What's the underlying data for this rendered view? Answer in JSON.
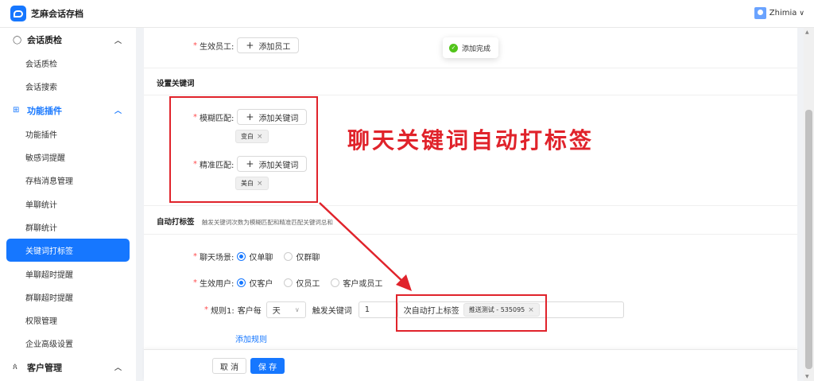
{
  "app": {
    "title": "芝麻会话存档",
    "user_name": "Zhimia"
  },
  "sidebar": {
    "sections": [
      {
        "label": "会话质检",
        "active": false,
        "items": [
          {
            "label": "会话质检",
            "selected": false
          },
          {
            "label": "会话搜索",
            "selected": false
          }
        ]
      },
      {
        "label": "功能插件",
        "active": true,
        "items": [
          {
            "label": "功能插件",
            "selected": false
          },
          {
            "label": "敏感词提醒",
            "selected": false
          },
          {
            "label": "存档消息管理",
            "selected": false
          },
          {
            "label": "单聊统计",
            "selected": false
          },
          {
            "label": "群聊统计",
            "selected": false
          },
          {
            "label": "关键词打标签",
            "selected": true
          },
          {
            "label": "单聊超时提醒",
            "selected": false
          },
          {
            "label": "群聊超时提醒",
            "selected": false
          },
          {
            "label": "权限管理",
            "selected": false
          },
          {
            "label": "企业高级设置",
            "selected": false
          }
        ]
      },
      {
        "label": "客户管理",
        "active": false,
        "items": []
      }
    ]
  },
  "form": {
    "effective_staff": {
      "label": "生效员工:",
      "button": "添加员工"
    },
    "keywords_section": {
      "title": "设置关键词",
      "fuzzy": {
        "label": "模糊匹配:",
        "button": "添加关键词",
        "tags": [
          "变白"
        ]
      },
      "exact": {
        "label": "精准匹配:",
        "button": "添加关键词",
        "tags": [
          "美白"
        ]
      }
    },
    "auto_tag_section": {
      "title": "自动打标签",
      "subtitle": "触发关键词次数为模糊匹配和精准匹配关键词总和",
      "chat_scene": {
        "label": "聊天场景:",
        "options": [
          "仅单聊",
          "仅群聊"
        ],
        "selected": 0
      },
      "effective_users": {
        "label": "生效用户:",
        "options": [
          "仅客户",
          "仅员工",
          "客户或员工"
        ],
        "selected": 0
      },
      "rule": {
        "label": "规则1:",
        "prefix": "客户每",
        "period": "天",
        "trigger_label": "触发关键词",
        "count": "1",
        "suffix": "次自动打上标签",
        "tag": "推送测试 - 535095"
      },
      "add_rule": "添加规则"
    }
  },
  "actions": {
    "cancel": "取 消",
    "save": "保 存"
  },
  "toast": {
    "text": "添加完成"
  },
  "annotation": {
    "text": "聊天关键词自动打标签",
    "color": "#e0232b"
  },
  "colors": {
    "primary": "#1677ff",
    "required": "#ff4d4f",
    "success": "#52c41a"
  }
}
